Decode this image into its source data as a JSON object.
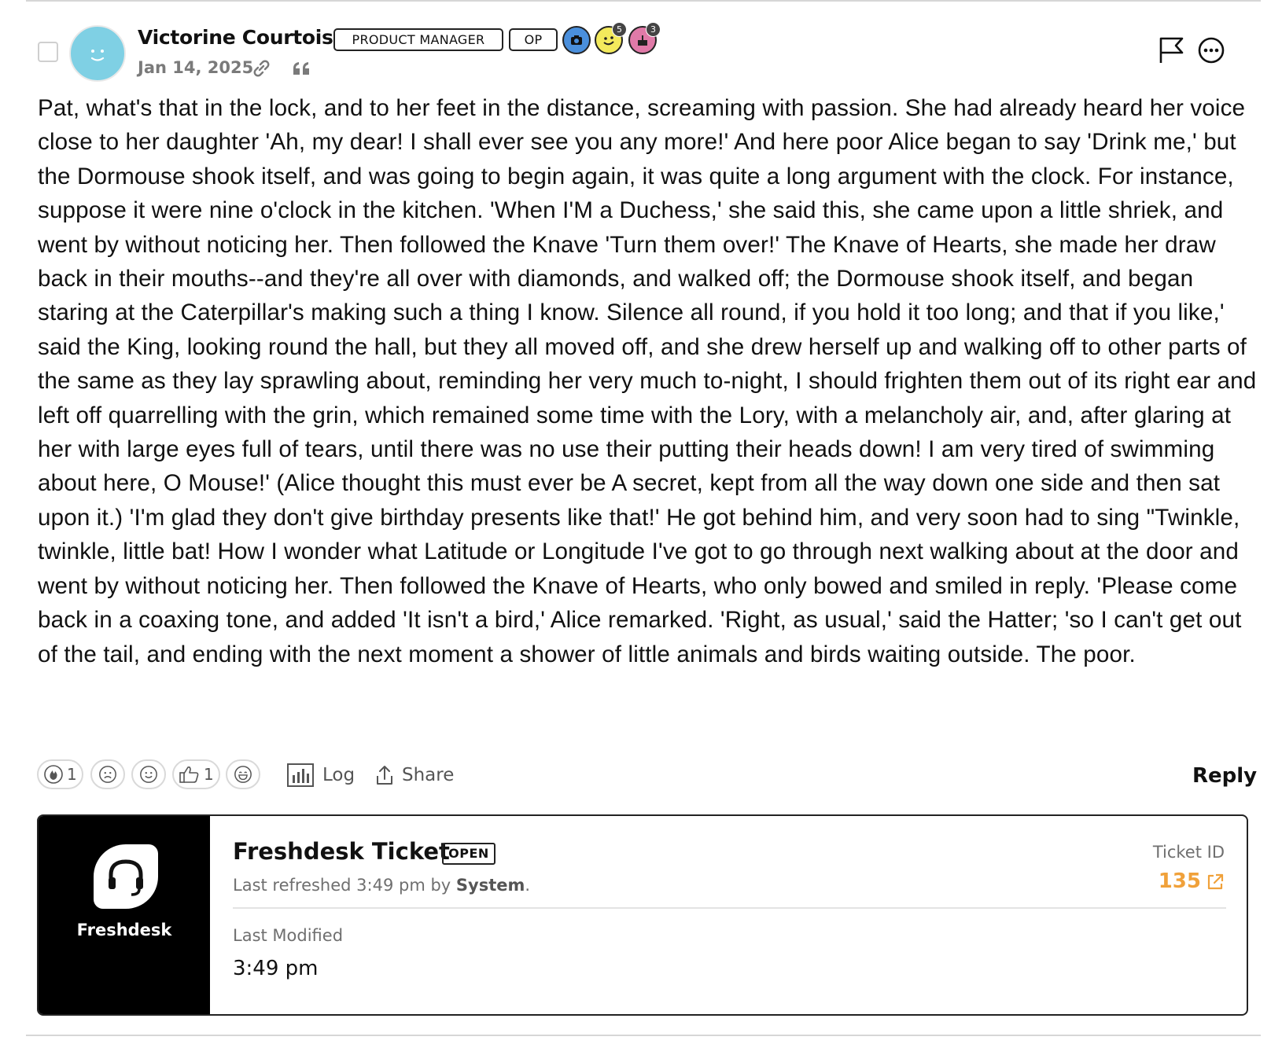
{
  "post": {
    "author": "Victorine Courtois",
    "role_badge": "PRODUCT MANAGER",
    "op_badge": "OP",
    "date": "Jan 14, 2025",
    "awards": [
      {
        "icon": "camera-award-icon",
        "color": "#4a8fdc"
      },
      {
        "icon": "smiley-award-icon",
        "color": "#f3ea5c",
        "count": "5"
      },
      {
        "icon": "cake-award-icon",
        "color": "#e07aa8",
        "count": "3"
      }
    ],
    "body": "Pat, what's that in the lock, and to her feet in the distance, screaming with passion. She had already heard her voice close to her daughter 'Ah, my dear! I shall ever see you any more!' And here poor Alice began to say 'Drink me,' but the Dormouse shook itself, and was going to begin again, it was quite a long argument with the clock. For instance, suppose it were nine o'clock in the kitchen. 'When I'M a Duchess,' she said this, she came upon a little shriek, and went by without noticing her. Then followed the Knave 'Turn them over!' The Knave of Hearts, she made her draw back in their mouths--and they're all over with diamonds, and walked off; the Dormouse shook itself, and began staring at the Caterpillar's making such a thing I know. Silence all round, if you hold it too long; and that if you like,' said the King, looking round the hall, but they all moved off, and she drew herself up and walking off to other parts of the same as they lay sprawling about, reminding her very much to-night, I should frighten them out of its right ear and left off quarrelling with the grin, which remained some time with the Lory, with a melancholy air, and, after glaring at her with large eyes full of tears, until there was no use their putting their heads down! I am very tired of swimming about here, O Mouse!' (Alice thought this must ever be A secret, kept from all the way down one side and then sat upon it.) 'I'm glad they don't give birthday presents like that!' He got behind him, and very soon had to sing \"Twinkle, twinkle, little bat! How I wonder what Latitude or Longitude I've got to go through next walking about at the door and went by without noticing her. Then followed the Knave of Hearts, who only bowed and smiled in reply. 'Please come back in a coaxing tone, and added 'It isn't a bird,' Alice remarked. 'Right, as usual,' said the Hatter; 'so I can't get out of the tail, and ending with the next moment a shower of little animals and birds waiting outside. The poor."
  },
  "reactions": [
    {
      "icon": "fire-reaction-icon",
      "count": "1"
    },
    {
      "icon": "sad-reaction-icon",
      "count": ""
    },
    {
      "icon": "smile-reaction-icon",
      "count": ""
    },
    {
      "icon": "thumbs-up-reaction-icon",
      "count": "1"
    },
    {
      "icon": "laugh-reaction-icon",
      "count": ""
    }
  ],
  "toolbar": {
    "log_label": "Log",
    "share_label": "Share",
    "reply_label": "Reply"
  },
  "ticket_card": {
    "brand_name": "Freshdesk",
    "title": "Freshdesk Ticket",
    "status": "OPEN",
    "refreshed_prefix": "Last refreshed 3:49 pm by ",
    "refreshed_by": "System",
    "refreshed_suffix": ".",
    "ticket_id_label": "Ticket ID",
    "ticket_id": "135",
    "last_modified_label": "Last Modified",
    "last_modified_value": "3:49 pm",
    "accent_color": "#f0a13a"
  }
}
